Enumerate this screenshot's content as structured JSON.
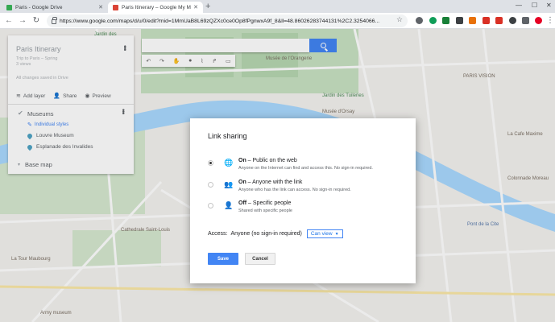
{
  "browser": {
    "tabs": [
      {
        "title": "Paris - Google Drive",
        "favicon_color": "#34a853",
        "active": false
      },
      {
        "title": "Paris Itinerary – Google My Maps",
        "favicon_color": "#db4437",
        "active": true
      }
    ],
    "new_tab": "+",
    "url": "https://www.google.com/maps/d/u/0/edit?mid=1MmUaB8L69zQZXc0ce0Op8fPgnwxA9f_8&ll=48.86026283744131%2C2.3254066...",
    "extension_colors": [
      "#5f6368",
      "#0f9d58",
      "#188038",
      "#3c4043",
      "#e8710a",
      "#d93025",
      "#d93025",
      "#5f6368",
      "#3c4043",
      "#e60023",
      "#5f6368"
    ]
  },
  "map": {
    "labels": [
      {
        "text": "Jardin des",
        "style": "green"
      },
      {
        "text": "Musée de l'Orangerie",
        "style": "normal"
      },
      {
        "text": "Jardin des Tuileries",
        "style": "green"
      },
      {
        "text": "Musée d'Orsay",
        "style": "normal"
      },
      {
        "text": "PARIS VISION",
        "style": "normal"
      },
      {
        "text": "La Cafe Maxime",
        "style": "normal"
      },
      {
        "text": "Cathedrale Saint-Louis",
        "style": "normal"
      },
      {
        "text": "Colonnade Moreau",
        "style": "normal"
      },
      {
        "text": "La Tour Maubourg",
        "style": "normal"
      },
      {
        "text": "Army museum",
        "style": "normal"
      },
      {
        "text": "Pont de la Cite",
        "style": "blue"
      }
    ]
  },
  "panel": {
    "title": "Paris Itinerary",
    "subtitle_line1": "Trip to Paris – Spring",
    "subtitle_line2": "3 views",
    "saved": "All changes saved in Drive",
    "actions": {
      "add_layer": "Add layer",
      "share": "Share",
      "preview": "Preview"
    },
    "layer": {
      "name": "Museums",
      "style": "Individual styles",
      "places": [
        "Louvre Museum",
        "Esplanade des Invalides"
      ]
    },
    "base_map": "Base map"
  },
  "dialog": {
    "title": "Link sharing",
    "options": [
      {
        "label_bold": "On",
        "label_rest": " – Public on the web",
        "desc": "Anyone on the Internet can find and access this. No sign-in required.",
        "selected": true
      },
      {
        "label_bold": "On",
        "label_rest": " – Anyone with the link",
        "desc": "Anyone who has the link can access. No sign-in required.",
        "selected": false
      },
      {
        "label_bold": "Off",
        "label_rest": " – Specific people",
        "desc": "Shared with specific people",
        "selected": false
      }
    ],
    "access_label": "Access:",
    "access_value": "Anyone (no sign-in required)",
    "permission": "Can view",
    "save": "Save",
    "cancel": "Cancel"
  }
}
